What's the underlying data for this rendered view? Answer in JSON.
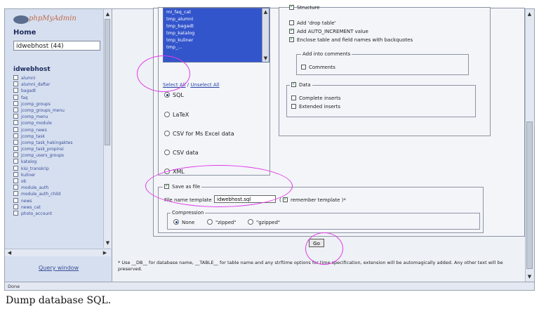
{
  "sidebar": {
    "logo_text": "phpMyAdmin",
    "home_label": "Home",
    "db_select_value": "idwebhost (44)",
    "db_name": "idwebhost",
    "tables": [
      "alumni",
      "alumni_daftar",
      "bagadt",
      "faq",
      "jcomp_groups",
      "jcomp_groups_menu",
      "jcomp_menu",
      "jcomp_module",
      "jcomp_news",
      "jcomp_task",
      "jcomp_task_hakingaktes",
      "jcomp_task_propinsi",
      "jcomp_users_groups",
      "katalog",
      "kisi_transkrip",
      "kuliner",
      "ob",
      "module_auth",
      "module_auth_child",
      "news",
      "news_cat",
      "photo_account"
    ],
    "query_window_label": "Query window"
  },
  "export": {
    "tables_selected": [
      "mi_faq_cat",
      "tmp_alumni",
      "tmp_bagadt",
      "tmp_katalog",
      "tmp_kuliner",
      "tmp_..."
    ],
    "select_all_label": "Select All",
    "unselect_all_label": "Unselect All",
    "formats": [
      {
        "label": "SQL",
        "selected": true
      },
      {
        "label": "LaTeX",
        "selected": false
      },
      {
        "label": "CSV for Ms Excel data",
        "selected": false
      },
      {
        "label": "CSV data",
        "selected": false
      },
      {
        "label": "XML",
        "selected": false
      }
    ],
    "structure_label": "Structure",
    "structure_options": [
      {
        "label": "Add 'drop table'",
        "checked": false
      },
      {
        "label": "Add AUTO_INCREMENT value",
        "checked": true
      },
      {
        "label": "Enclose table and field names with backquotes",
        "checked": true
      }
    ],
    "comments_legend": "Add into comments",
    "comments_label": "Comments",
    "data_label": "Data",
    "data_options": [
      {
        "label": "Complete inserts",
        "checked": false
      },
      {
        "label": "Extended inserts",
        "checked": false
      }
    ],
    "save_as_file_label": "Save as file",
    "file_template_label": "File name template",
    "file_template_value": "idwebhost.sql",
    "remember_template_label": "remember template )*",
    "compression_legend": "Compression",
    "compression": [
      {
        "label": "None",
        "selected": true
      },
      {
        "label": "\"zipped\"",
        "selected": false
      },
      {
        "label": "\"gzipped\"",
        "selected": false
      }
    ],
    "go_label": "Go",
    "footnote": "* Use __DB__ for database name, __TABLE__ for table name and any strftime options for time specification, extension will be automagically added. Any other text will be preserved."
  },
  "status_text": "Done",
  "caption": "Dump database SQL.",
  "colors": {
    "highlight": "#e13be8",
    "selection": "#3355cc"
  }
}
